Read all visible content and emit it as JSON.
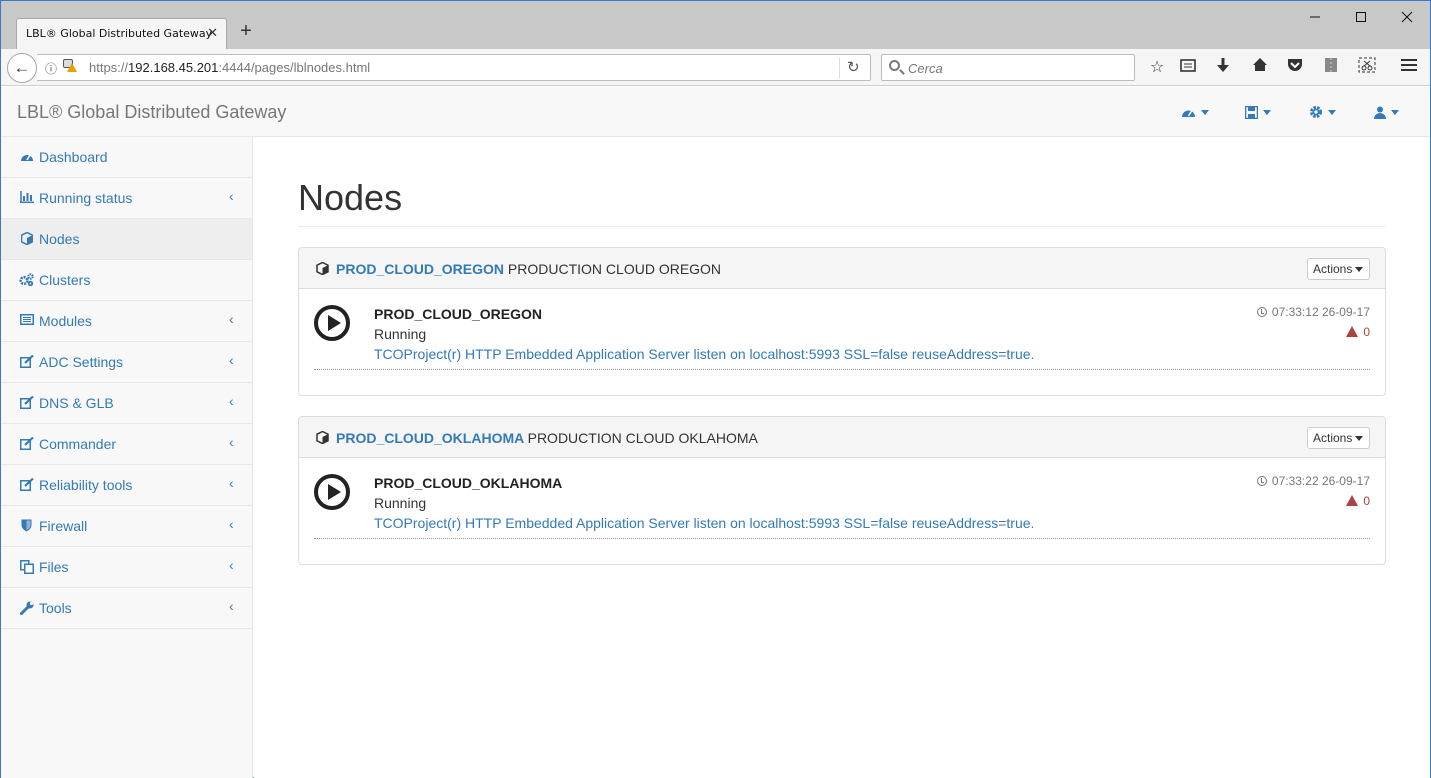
{
  "browser": {
    "tab_title": "LBL® Global Distributed Gateway",
    "tab_close": "✕",
    "new_tab": "+",
    "url_prefix": "https://",
    "url_host": "192.168.45.201",
    "url_path": ":4444/pages/lblnodes.html",
    "search_placeholder": "Cerca"
  },
  "header": {
    "brand": "LBL® Global Distributed Gateway",
    "menus": [
      {
        "icon": "dashboard-icon"
      },
      {
        "icon": "save-icon"
      },
      {
        "icon": "gear-icon"
      },
      {
        "icon": "user-icon"
      }
    ]
  },
  "sidebar": {
    "items": [
      {
        "label": "Dashboard",
        "icon": "dashboard-icon",
        "has_submenu": false,
        "active": false
      },
      {
        "label": "Running status",
        "icon": "bar-chart-icon",
        "has_submenu": true,
        "active": false
      },
      {
        "label": "Nodes",
        "icon": "cube-icon",
        "has_submenu": false,
        "active": true
      },
      {
        "label": "Clusters",
        "icon": "cogs-icon",
        "has_submenu": false,
        "active": false
      },
      {
        "label": "Modules",
        "icon": "list-icon",
        "has_submenu": true,
        "active": false
      },
      {
        "label": "ADC Settings",
        "icon": "edit-icon",
        "has_submenu": true,
        "active": false
      },
      {
        "label": "DNS & GLB",
        "icon": "edit-icon",
        "has_submenu": true,
        "active": false
      },
      {
        "label": "Commander",
        "icon": "edit-icon",
        "has_submenu": true,
        "active": false
      },
      {
        "label": "Reliability tools",
        "icon": "edit-icon",
        "has_submenu": true,
        "active": false
      },
      {
        "label": "Firewall",
        "icon": "shield-icon",
        "has_submenu": true,
        "active": false
      },
      {
        "label": "Files",
        "icon": "files-icon",
        "has_submenu": true,
        "active": false
      },
      {
        "label": "Tools",
        "icon": "wrench-icon",
        "has_submenu": true,
        "active": false
      }
    ]
  },
  "main": {
    "title": "Nodes",
    "nodes": [
      {
        "id": "PROD_CLOUD_OREGON",
        "description": "PRODUCTION CLOUD OREGON",
        "actions_label": "Actions",
        "name": "PROD_CLOUD_OREGON",
        "status": "Running",
        "message": "TCOProject(r) HTTP Embedded Application Server listen on localhost:5993 SSL=false reuseAddress=true.",
        "timestamp": "07:33:12 26-09-17",
        "warnings": "0"
      },
      {
        "id": "PROD_CLOUD_OKLAHOMA",
        "description": "PRODUCTION CLOUD OKLAHOMA",
        "actions_label": "Actions",
        "name": "PROD_CLOUD_OKLAHOMA",
        "status": "Running",
        "message": "TCOProject(r) HTTP Embedded Application Server listen on localhost:5993 SSL=false reuseAddress=true.",
        "timestamp": "07:33:22 26-09-17",
        "warnings": "0"
      }
    ]
  },
  "colors": {
    "link": "#337ab7",
    "warning": "#a94442",
    "header_bg": "#f8f8f8"
  }
}
